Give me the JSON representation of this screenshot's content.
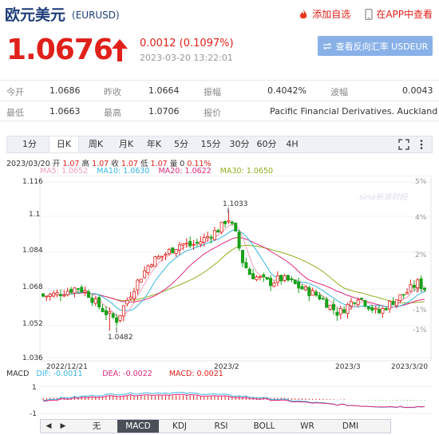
{
  "header": {
    "title": "欧元美元",
    "code": "(EURUSD)",
    "fav_label": "添加自选",
    "app_label": "在APP中查看"
  },
  "quote": {
    "price": "1.0676",
    "change": "0.0012 (0.1097%)",
    "time": "2023-03-20 13:22:01",
    "reverse_label": "查看反向汇率 USDEUR"
  },
  "stats": {
    "open_label": "今开",
    "open": "1.0686",
    "prev_label": "昨收",
    "prev": "1.0664",
    "amp_label": "振幅",
    "amp": "0.4042%",
    "wave_label": "波幅",
    "wave": "0.0043",
    "low_label": "最低",
    "low": "1.0663",
    "high_label": "最高",
    "high": "1.0706",
    "report_label": "报价",
    "report": "Pacific Financial Derivatives. Auckland"
  },
  "tabs": [
    "1分",
    "日K",
    "周K",
    "月K",
    "年K",
    "5分",
    "15分",
    "30分",
    "60分",
    "4H"
  ],
  "active_tab": "日K",
  "bar_info": {
    "date": "2023/03/20",
    "open_l": "开",
    "open": "1.07",
    "high_l": "高",
    "high": "1.07",
    "close_l": "收",
    "close": "1.07",
    "low_l": "低",
    "low": "1.07",
    "vol_l": "量",
    "vol": "0",
    "pct": "0.11%"
  },
  "ma_labels": {
    "ma5": "MA5: 1.0652",
    "ma10": "MA10: 1.0630",
    "ma20": "MA20: 1.0622",
    "ma30": "MA30: 1.0650"
  },
  "colors": {
    "up": "#e0201a",
    "down": "#1aa11a",
    "ma5": "#f0a0b8",
    "ma10": "#38b6e0",
    "ma20": "#e0287a",
    "ma30": "#90b020",
    "accent": "#1f3d7a"
  },
  "chart_data": {
    "type": "candlestick",
    "y_ticks": [
      "1.116",
      "1.1",
      "1.084",
      "1.068",
      "1.052",
      "1.036"
    ],
    "pct_ticks": [
      "5%",
      "4%",
      "2%",
      "0%",
      "-1%",
      "-1%"
    ],
    "x_labels": [
      "2022/12/21",
      "2023/2",
      "2023/3",
      "2023/3/20"
    ],
    "annotations": {
      "max": "1.1033",
      "min": "1.0482"
    },
    "watermark": "sina新浪财经",
    "ylim": [
      1.036,
      1.116
    ]
  },
  "macd": {
    "label": "MACD",
    "dif": "DIF: -0.0011",
    "dea": "DEA: -0.0022",
    "macd": "MACD: 0.0021",
    "y_ticks": [
      "1",
      "-1"
    ]
  },
  "bottom_tabs": [
    "无",
    "MACD",
    "KDJ",
    "RSI",
    "BOLL",
    "WR",
    "DMI"
  ],
  "bottom_active": "MACD",
  "nav_icons": [
    "triangle-left-icon",
    "triangle-right-icon"
  ]
}
